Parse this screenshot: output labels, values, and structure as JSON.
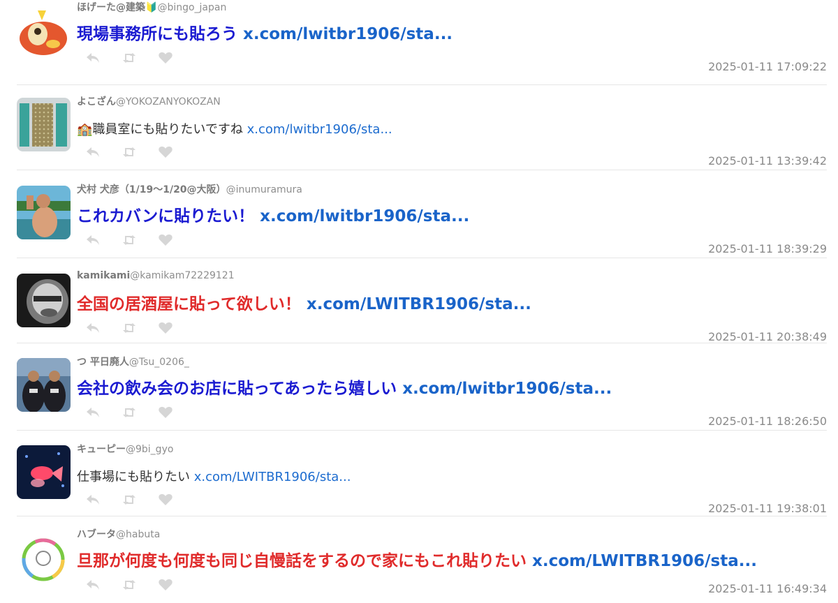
{
  "colors": {
    "message_blue": "#1b1bd1",
    "message_red": "#e02b2b",
    "link": "#1a64c9",
    "meta_gray": "#8a8a8a",
    "action_icon": "#d6d6d6"
  },
  "actions": {
    "reply_icon": "reply-icon",
    "retweet_icon": "retweet-icon",
    "like_icon": "heart-icon"
  },
  "tweets": [
    {
      "display_name": "ほげーた@建築🔰",
      "handle": "@bingo_japan",
      "message": "現場事務所にも貼ろう",
      "link": "x.com/lwitbr1906/sta...",
      "timestamp": "2025-01-11 17:09:22",
      "style": "big-blue"
    },
    {
      "display_name": "よこざん",
      "handle": "@YOKOZANYOKOZAN",
      "message": "🏫職員室にも貼りたいですね",
      "link": "x.com/lwitbr1906/sta...",
      "timestamp": "2025-01-11 13:39:42",
      "style": "small"
    },
    {
      "display_name": "犬村 犬彦（1/19〜1/20@大阪）",
      "handle": "@inumuramura",
      "message": "これカバンに貼りたい！",
      "link": "x.com/lwitbr1906/sta...",
      "timestamp": "2025-01-11 18:39:29",
      "style": "big-blue"
    },
    {
      "display_name": "kamikami",
      "handle": "@kamikam72229121",
      "message": "全国の居酒屋に貼って欲しい！",
      "link": "x.com/LWITBR1906/sta...",
      "timestamp": "2025-01-11 20:38:49",
      "style": "big-red"
    },
    {
      "display_name": "つ 平日廃人",
      "handle": "@Tsu_0206_",
      "message": "会社の飲み会のお店に貼ってあったら嬉しい",
      "link": "x.com/lwitbr1906/sta...",
      "timestamp": "2025-01-11 18:26:50",
      "style": "big-blue"
    },
    {
      "display_name": "キューピー",
      "handle": "@9bi_gyo",
      "message": "仕事場にも貼りたい",
      "link": "x.com/LWITBR1906/sta...",
      "timestamp": "2025-01-11 19:38:01",
      "style": "small"
    },
    {
      "display_name": "ハブータ",
      "handle": "@habuta",
      "message": "旦那が何度も何度も同じ自慢話をするので家にもこれ貼りたい",
      "link": "x.com/LWITBR1906/sta...",
      "timestamp": "2025-01-11 16:49:34",
      "style": "big-red"
    }
  ]
}
